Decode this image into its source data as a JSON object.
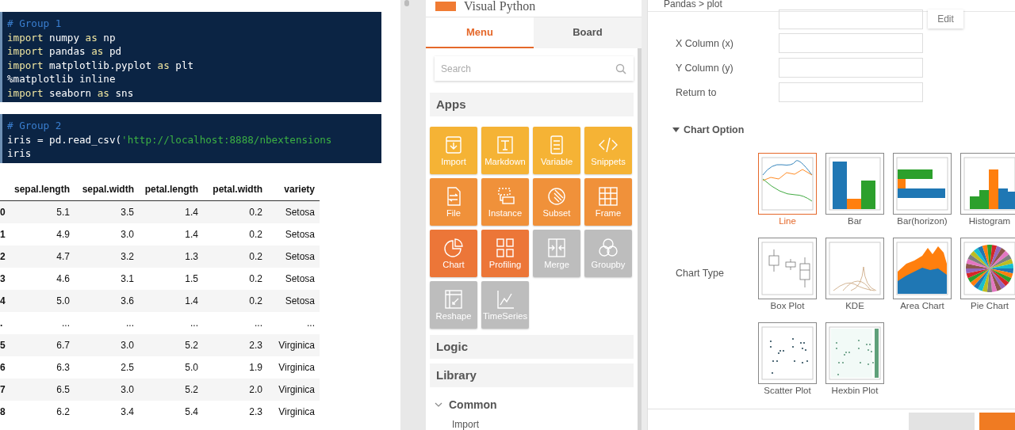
{
  "notebook": {
    "cells": [
      {
        "lines": [
          [
            {
              "kind": "comment",
              "text": "# Group 1"
            }
          ],
          [
            {
              "kind": "keyword",
              "text": "import"
            },
            {
              "kind": "plain",
              "text": " numpy "
            },
            {
              "kind": "keyword",
              "text": "as"
            },
            {
              "kind": "plain",
              "text": " np"
            }
          ],
          [
            {
              "kind": "keyword",
              "text": "import"
            },
            {
              "kind": "plain",
              "text": " pandas "
            },
            {
              "kind": "keyword",
              "text": "as"
            },
            {
              "kind": "plain",
              "text": " pd"
            }
          ],
          [
            {
              "kind": "keyword",
              "text": "import"
            },
            {
              "kind": "plain",
              "text": " matplotlib.pyplot "
            },
            {
              "kind": "keyword",
              "text": "as"
            },
            {
              "kind": "plain",
              "text": " plt"
            }
          ],
          [
            {
              "kind": "plain",
              "text": "%matplotlib inline"
            }
          ],
          [
            {
              "kind": "keyword",
              "text": "import"
            },
            {
              "kind": "plain",
              "text": " seaborn "
            },
            {
              "kind": "keyword",
              "text": "as"
            },
            {
              "kind": "plain",
              "text": " sns"
            }
          ]
        ]
      },
      {
        "lines": [
          [
            {
              "kind": "comment",
              "text": "# Group 2"
            }
          ],
          [
            {
              "kind": "plain",
              "text": "iris = pd.read_csv("
            },
            {
              "kind": "string",
              "text": "'http://localhost:8888/nbextensions"
            }
          ],
          [
            {
              "kind": "plain",
              "text": "iris"
            }
          ]
        ]
      }
    ],
    "table": {
      "columns": [
        "sepal.length",
        "sepal.width",
        "petal.length",
        "petal.width",
        "variety"
      ],
      "rows": [
        {
          "index": "0",
          "cells": [
            "5.1",
            "3.5",
            "1.4",
            "0.2",
            "Setosa"
          ]
        },
        {
          "index": "1",
          "cells": [
            "4.9",
            "3.0",
            "1.4",
            "0.2",
            "Setosa"
          ]
        },
        {
          "index": "2",
          "cells": [
            "4.7",
            "3.2",
            "1.3",
            "0.2",
            "Setosa"
          ]
        },
        {
          "index": "3",
          "cells": [
            "4.6",
            "3.1",
            "1.5",
            "0.2",
            "Setosa"
          ]
        },
        {
          "index": "4",
          "cells": [
            "5.0",
            "3.6",
            "1.4",
            "0.2",
            "Setosa"
          ]
        },
        {
          "index": ".",
          "cells": [
            "...",
            "...",
            "...",
            "...",
            "..."
          ]
        },
        {
          "index": "5",
          "cells": [
            "6.7",
            "3.0",
            "5.2",
            "2.3",
            "Virginica"
          ]
        },
        {
          "index": "6",
          "cells": [
            "6.3",
            "2.5",
            "5.0",
            "1.9",
            "Virginica"
          ]
        },
        {
          "index": "7",
          "cells": [
            "6.5",
            "3.0",
            "5.2",
            "2.0",
            "Virginica"
          ]
        },
        {
          "index": "8",
          "cells": [
            "6.2",
            "3.4",
            "5.4",
            "2.3",
            "Virginica"
          ]
        }
      ]
    }
  },
  "menu_panel": {
    "title": "Visual Python",
    "tabs": [
      {
        "label": "Menu",
        "selected": true
      },
      {
        "label": "Board",
        "selected": false
      }
    ],
    "search": {
      "placeholder": "Search"
    },
    "apps_title": "Apps",
    "apps": [
      {
        "label": "Import",
        "kind": "import",
        "color": "#f5b335"
      },
      {
        "label": "Markdown",
        "kind": "markdown",
        "color": "#f5b335"
      },
      {
        "label": "Variable",
        "kind": "variable",
        "color": "#f5b335"
      },
      {
        "label": "Snippets",
        "kind": "snippets",
        "color": "#f5b335"
      },
      {
        "label": "File",
        "kind": "file",
        "color": "#f0913a"
      },
      {
        "label": "Instance",
        "kind": "instance",
        "color": "#f0913a"
      },
      {
        "label": "Subset",
        "kind": "subset",
        "color": "#f0913a"
      },
      {
        "label": "Frame",
        "kind": "frame",
        "color": "#f0913a"
      },
      {
        "label": "Chart",
        "kind": "chart",
        "color": "#ec7638"
      },
      {
        "label": "Profiling",
        "kind": "profiling",
        "color": "#ec7638"
      },
      {
        "label": "Merge",
        "kind": "merge",
        "color": "#bdbdbd"
      },
      {
        "label": "Groupby",
        "kind": "groupby",
        "color": "#bdbdbd"
      },
      {
        "label": "Reshape",
        "kind": "reshape",
        "color": "#bdbdbd"
      },
      {
        "label": "TimeSeries",
        "kind": "timeseries",
        "color": "#bdbdbd"
      }
    ],
    "logic_title": "Logic",
    "library": {
      "title": "Library",
      "children": [
        {
          "label": "Common",
          "expanded": true,
          "children": [
            {
              "label": "Import"
            }
          ]
        }
      ]
    }
  },
  "plot_panel": {
    "breadcrumb": "Pandas > plot",
    "edit_button": "Edit",
    "fields": [
      {
        "label": "X Column (x)"
      },
      {
        "label": "Y Column (y)"
      },
      {
        "label": "Return to"
      }
    ],
    "chart_option": {
      "label": "Chart Option",
      "expanded": true
    },
    "chart_type_label": "Chart Type",
    "chart_types": [
      {
        "label": "Line",
        "kind": "line",
        "selected": true
      },
      {
        "label": "Bar",
        "kind": "bar",
        "selected": false
      },
      {
        "label": "Bar(horizon)",
        "kind": "barh",
        "selected": false
      },
      {
        "label": "Histogram",
        "kind": "hist",
        "selected": false
      },
      {
        "label": "Box Plot",
        "kind": "box",
        "selected": false
      },
      {
        "label": "KDE",
        "kind": "kde",
        "selected": false
      },
      {
        "label": "Area Chart",
        "kind": "area",
        "selected": false
      },
      {
        "label": "Pie Chart",
        "kind": "pie",
        "selected": false
      },
      {
        "label": "Scatter Plot",
        "kind": "scatter",
        "selected": false
      },
      {
        "label": "Hexbin Plot",
        "kind": "hexbin",
        "selected": false
      }
    ]
  }
}
